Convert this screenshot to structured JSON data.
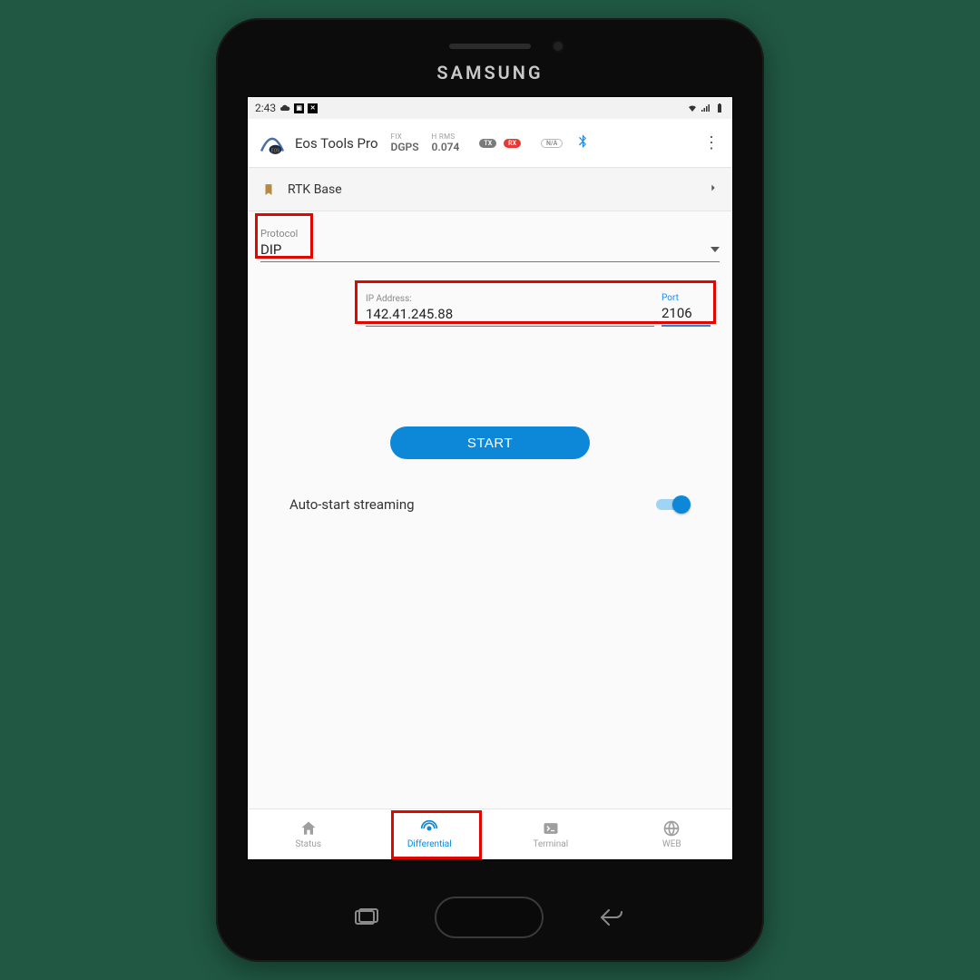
{
  "device": {
    "brand": "SAMSUNG"
  },
  "statusbar": {
    "time": "2:43"
  },
  "header": {
    "app_title": "Eos Tools Pro",
    "fix_label": "FIX",
    "fix_value": "DGPS",
    "hrms_label": "H RMS",
    "hrms_value": "0.074",
    "tx": "TX",
    "rx": "RX",
    "na": "N/A"
  },
  "rtk": {
    "label": "RTK Base"
  },
  "protocol": {
    "label": "Protocol",
    "value": "DIP"
  },
  "ip": {
    "label": "IP Address:",
    "value": "142.41.245.88",
    "port_label": "Port",
    "port_value": "2106"
  },
  "buttons": {
    "start": "START"
  },
  "autostart": {
    "label": "Auto-start streaming",
    "on": true
  },
  "nav": {
    "status": "Status",
    "differential": "Differential",
    "terminal": "Terminal",
    "web": "WEB",
    "active": "differential"
  }
}
